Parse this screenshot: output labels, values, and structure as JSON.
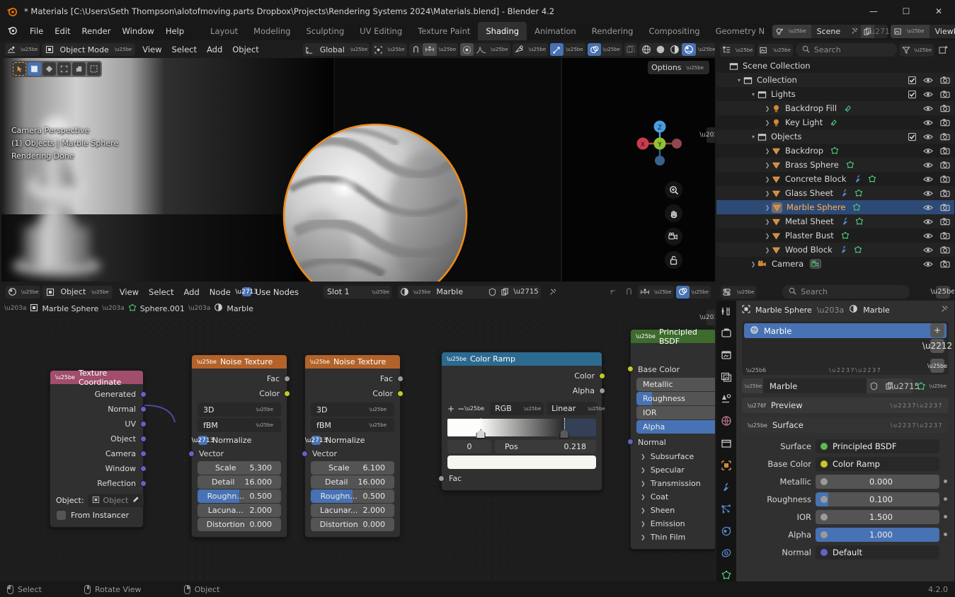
{
  "titlebar": {
    "title": "* Materials [C:\\Users\\Seth Thompson\\alotofmoving.parts Dropbox\\Projects\\Rendering Systems 2024\\Materials.blend] - Blender 4.2",
    "minimize": "—",
    "maximize": "☐",
    "close": "✕"
  },
  "topbar": {
    "menus": [
      "File",
      "Edit",
      "Render",
      "Window",
      "Help"
    ],
    "workspaces": [
      "Layout",
      "Modeling",
      "Sculpting",
      "UV Editing",
      "Texture Paint",
      "Shading",
      "Animation",
      "Rendering",
      "Compositing",
      "Geometry N"
    ],
    "active_workspace": "Shading",
    "scene_name": "Scene",
    "viewlayer_name": "ViewLayer"
  },
  "viewport": {
    "mode": "Object Mode",
    "menus": [
      "View",
      "Select",
      "Add",
      "Object"
    ],
    "transform_orientation": "Global",
    "options_label": "Options",
    "overlay_line1": "Camera Perspective",
    "overlay_line2": "(1) Objects | Marble Sphere",
    "overlay_line3": "Rendering Done",
    "gizmo_axes": [
      "X",
      "Y",
      "Z"
    ]
  },
  "node_editor": {
    "editor_type_icon": "shader-editor-icon",
    "shader_type": "Object",
    "menus": [
      "View",
      "Select",
      "Add",
      "Node"
    ],
    "use_nodes_label": "Use Nodes",
    "use_nodes_checked": true,
    "slot": "Slot 1",
    "material_name": "Marble",
    "breadcrumb": [
      "Marble Sphere",
      "Sphere.001",
      "Marble"
    ],
    "nodes": {
      "texture_coordinate": {
        "title": "Texture Coordinate",
        "header_color": "#a04d6e",
        "outputs": [
          "Generated",
          "Normal",
          "UV",
          "Object",
          "Camera",
          "Window",
          "Reflection"
        ],
        "object_label": "Object:",
        "object_value": "Object",
        "from_instancer_label": "From Instancer",
        "from_instancer_checked": false
      },
      "noise_texture_1": {
        "title": "Noise Texture",
        "header_color": "#b3622a",
        "outputs": [
          "Fac",
          "Color"
        ],
        "dimension": "3D",
        "noise_type": "fBM",
        "normalize_label": "Normalize",
        "normalize_checked": true,
        "vector_label": "Vector",
        "props": [
          {
            "label": "Scale",
            "value": "5.300",
            "fill": 0
          },
          {
            "label": "Detail",
            "value": "16.000",
            "fill": 0
          },
          {
            "label": "Roughn...",
            "value": "0.500",
            "fill": 50
          },
          {
            "label": "Lacuna...",
            "value": "2.000",
            "fill": 0
          },
          {
            "label": "Distortion",
            "value": "0.000",
            "fill": 0
          }
        ]
      },
      "noise_texture_2": {
        "title": "Noise Texture",
        "header_color": "#b3622a",
        "outputs": [
          "Fac",
          "Color"
        ],
        "dimension": "3D",
        "noise_type": "fBM",
        "normalize_label": "Normalize",
        "normalize_checked": true,
        "vector_label": "Vector",
        "props": [
          {
            "label": "Scale",
            "value": "6.100",
            "fill": 0
          },
          {
            "label": "Detail",
            "value": "16.000",
            "fill": 0
          },
          {
            "label": "Roughn...",
            "value": "0.500",
            "fill": 50
          },
          {
            "label": "Lacunar...",
            "value": "2.000",
            "fill": 0
          },
          {
            "label": "Distortion",
            "value": "0.000",
            "fill": 0
          }
        ]
      },
      "color_ramp": {
        "title": "Color Ramp",
        "header_color": "#2c6a8f",
        "outputs": [
          "Color",
          "Alpha"
        ],
        "add_label": "+",
        "remove_label": "−",
        "color_mode": "RGB",
        "interpolation": "Linear",
        "index_value": "0",
        "pos_label": "Pos",
        "pos_value": "0.218",
        "input_label": "Fac",
        "stop_positions": [
          0.218,
          0.78
        ]
      },
      "principled_bsdf": {
        "title": "Principled BSDF",
        "header_color": "#3d6b2e",
        "inputs": [
          {
            "label": "Base Color",
            "type": "color",
            "socket": "#c7c729"
          },
          {
            "label": "Metallic",
            "type": "slider",
            "fill": 0
          },
          {
            "label": "Roughness",
            "type": "slider",
            "fill": 19
          },
          {
            "label": "IOR",
            "type": "slider",
            "fill": 0
          },
          {
            "label": "Alpha",
            "type": "slider",
            "fill": 100
          },
          {
            "label": "Normal",
            "type": "vector",
            "socket": "#6363c7"
          }
        ],
        "sections": [
          "Subsurface",
          "Specular",
          "Transmission",
          "Coat",
          "Sheen",
          "Emission",
          "Thin Film"
        ]
      }
    }
  },
  "outliner": {
    "search_placeholder": "Search",
    "rows": [
      {
        "label": "Scene Collection",
        "indent": 0,
        "icon": "collection-icon",
        "expander": "",
        "selected": false,
        "extra_icons": [],
        "toggles": []
      },
      {
        "label": "Collection",
        "indent": 1,
        "icon": "collection-icon",
        "expander": "down",
        "selected": false,
        "extra_icons": [],
        "toggles": [
          "check",
          "eye",
          "camera"
        ]
      },
      {
        "label": "Lights",
        "indent": 2,
        "icon": "collection-icon",
        "expander": "down",
        "selected": false,
        "extra_icons": [],
        "toggles": [
          "check",
          "eye",
          "camera"
        ]
      },
      {
        "label": "Backdrop Fill",
        "indent": 3,
        "icon": "light-icon",
        "expander": "right",
        "selected": false,
        "extra_icons": [
          "light-data-icon"
        ],
        "toggles": [
          "eye",
          "camera"
        ]
      },
      {
        "label": "Key Light",
        "indent": 3,
        "icon": "light-icon",
        "expander": "right",
        "selected": false,
        "extra_icons": [
          "light-data-icon"
        ],
        "toggles": [
          "eye",
          "camera"
        ]
      },
      {
        "label": "Objects",
        "indent": 2,
        "icon": "collection-icon",
        "expander": "down",
        "selected": false,
        "extra_icons": [],
        "toggles": [
          "check",
          "eye",
          "camera"
        ]
      },
      {
        "label": "Backdrop",
        "indent": 3,
        "icon": "mesh-icon",
        "expander": "right",
        "selected": false,
        "extra_icons": [
          "mesh-data-icon"
        ],
        "toggles": [
          "eye",
          "camera"
        ]
      },
      {
        "label": "Brass Sphere",
        "indent": 3,
        "icon": "mesh-icon",
        "expander": "right",
        "selected": false,
        "extra_icons": [
          "mesh-data-icon"
        ],
        "toggles": [
          "eye",
          "camera"
        ]
      },
      {
        "label": "Concrete  Block",
        "indent": 3,
        "icon": "mesh-icon",
        "expander": "right",
        "selected": false,
        "extra_icons": [
          "modifier-icon",
          "mesh-data-icon"
        ],
        "toggles": [
          "eye",
          "camera"
        ]
      },
      {
        "label": "Glass Sheet",
        "indent": 3,
        "icon": "mesh-icon",
        "expander": "right",
        "selected": false,
        "extra_icons": [
          "modifier-icon",
          "mesh-data-icon"
        ],
        "toggles": [
          "eye",
          "camera"
        ]
      },
      {
        "label": "Marble Sphere",
        "indent": 3,
        "icon": "mesh-icon",
        "expander": "right",
        "selected": true,
        "extra_icons": [
          "mesh-data-icon"
        ],
        "toggles": [
          "eye",
          "camera"
        ]
      },
      {
        "label": "Metal Sheet",
        "indent": 3,
        "icon": "mesh-icon",
        "expander": "right",
        "selected": false,
        "extra_icons": [
          "modifier-icon",
          "mesh-data-icon"
        ],
        "toggles": [
          "eye",
          "camera"
        ]
      },
      {
        "label": "Plaster Bust",
        "indent": 3,
        "icon": "mesh-icon",
        "expander": "right",
        "selected": false,
        "extra_icons": [
          "mesh-data-icon"
        ],
        "toggles": [
          "eye",
          "camera"
        ]
      },
      {
        "label": "Wood Block",
        "indent": 3,
        "icon": "mesh-icon",
        "expander": "right",
        "selected": false,
        "extra_icons": [
          "modifier-icon",
          "mesh-data-icon"
        ],
        "toggles": [
          "eye",
          "camera"
        ]
      },
      {
        "label": "Camera",
        "indent": 2,
        "icon": "camera-obj-icon",
        "expander": "right",
        "selected": false,
        "extra_icons": [
          "camera-data-icon"
        ],
        "toggles": [
          "eye",
          "camera"
        ]
      }
    ]
  },
  "properties": {
    "search_placeholder": "Search",
    "breadcrumb_object": "Marble Sphere",
    "breadcrumb_material": "Marble",
    "material_slot_name": "Marble",
    "material_datablock_name": "Marble",
    "preview_panel": "Preview",
    "surface_panel": "Surface",
    "fields": [
      {
        "label": "Surface",
        "value": "Principled BSDF",
        "kind": "link",
        "dot": "#5db94f",
        "fill": 0
      },
      {
        "label": "Base Color",
        "value": "Color Ramp",
        "kind": "link",
        "dot": "#c7c729",
        "fill": 0,
        "expander": true
      },
      {
        "label": "Metallic",
        "value": "0.000",
        "kind": "slider",
        "dot": "#9a9a9a",
        "fill": 0
      },
      {
        "label": "Roughness",
        "value": "0.100",
        "kind": "slider",
        "dot": "#9a9a9a",
        "fill": 10
      },
      {
        "label": "IOR",
        "value": "1.500",
        "kind": "slider",
        "dot": "#9a9a9a",
        "fill": 0
      },
      {
        "label": "Alpha",
        "value": "1.000",
        "kind": "slider",
        "dot": "#9a9a9a",
        "fill": 100
      },
      {
        "label": "Normal",
        "value": "Default",
        "kind": "link",
        "dot": "#6363c7",
        "fill": 0
      }
    ],
    "tabs": [
      "tool-icon",
      "render-icon",
      "output-icon",
      "viewlayer-icon",
      "scene-icon",
      "world-icon",
      "collection-icon",
      "object-icon",
      "modifier-icon",
      "particles-icon",
      "physics-icon",
      "constraint-icon",
      "data-icon"
    ]
  },
  "statusbar": {
    "items": [
      {
        "mouse": "left",
        "label": "Select"
      },
      {
        "mouse": "middle",
        "label": "Rotate View"
      },
      {
        "mouse": "right",
        "label": "Object"
      }
    ],
    "version": "4.2.0"
  }
}
